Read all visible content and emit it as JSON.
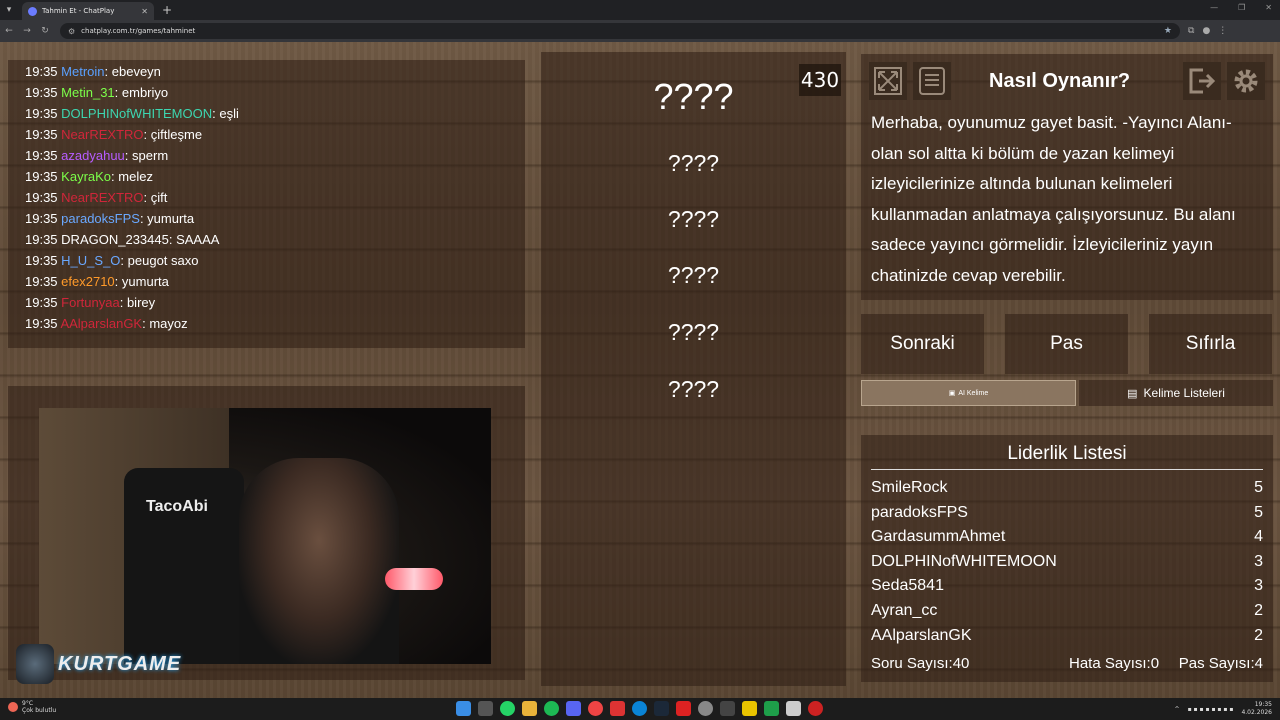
{
  "browser": {
    "tab_title": "Tahmin Et - ChatPlay",
    "url": "chatplay.com.tr/games/tahminet"
  },
  "chat": {
    "messages": [
      {
        "time": "19:35",
        "user": "Metroin",
        "color": "#5aa0ff",
        "text": "ebeveyn"
      },
      {
        "time": "19:35",
        "user": "Metin_31",
        "color": "#7cff4a",
        "text": "embriyo"
      },
      {
        "time": "19:35",
        "user": "DOLPHINofWHITEMOON",
        "color": "#3dd6b0",
        "text": "eşli"
      },
      {
        "time": "19:35",
        "user": "NearREXTRO",
        "color": "#d0263a",
        "text": "çiftleşme"
      },
      {
        "time": "19:35",
        "user": "azadyahuu",
        "color": "#b65cff",
        "text": "sperm"
      },
      {
        "time": "19:35",
        "user": "KayraKo",
        "color": "#7cff4a",
        "text": "melez"
      },
      {
        "time": "19:35",
        "user": "NearREXTRO",
        "color": "#d0263a",
        "text": "çift"
      },
      {
        "time": "19:35",
        "user": "paradoksFPS",
        "color": "#6aa8ff",
        "text": "yumurta"
      },
      {
        "time": "19:35",
        "user": "DRAGON_233445",
        "color": "#ffffff",
        "text": "SAAAA"
      },
      {
        "time": "19:35",
        "user": "H_U_S_O",
        "color": "#6aa8ff",
        "text": "peugot saxo"
      },
      {
        "time": "19:35",
        "user": "efex2710",
        "color": "#ff9a2a",
        "text": "yumurta"
      },
      {
        "time": "19:35",
        "user": "Fortunyaa",
        "color": "#d0263a",
        "text": "birey"
      },
      {
        "time": "19:35",
        "user": "AAlparslanGK",
        "color": "#d0263a",
        "text": "mayoz"
      }
    ]
  },
  "webcam": {
    "chair_text": "TacoAbi",
    "overlay_logo": "KURTGAME"
  },
  "game": {
    "score": "430",
    "words": [
      "????",
      "????",
      "????",
      "????",
      "????",
      "????"
    ]
  },
  "info": {
    "title": "Nasıl Oynanır?",
    "description": "Merhaba, oyunumuz gayet basit. -Yayıncı Alanı- olan sol altta ki bölüm de yazan kelimeyi izleyicilerinize altında bulunan kelimeleri kullanmadan anlatmaya çalışıyorsunuz. Bu alanı sadece yayıncı görmelidir. İzleyicileriniz yayın chatinizde cevap verebilir.",
    "icons": [
      "fullscreen-icon",
      "document-icon",
      "exit-icon",
      "settings-icon"
    ]
  },
  "controls": {
    "next": "Sonraki",
    "pass": "Pas",
    "reset": "Sıfırla",
    "ai_word": "AI Kelime",
    "word_lists": "Kelime Listeleri"
  },
  "leaderboard": {
    "title": "Liderlik Listesi",
    "rows": [
      {
        "name": "SmileRock",
        "score": "5"
      },
      {
        "name": "paradoksFPS",
        "score": "5"
      },
      {
        "name": "GardasummAhmet",
        "score": "4"
      },
      {
        "name": "DOLPHINofWHITEMOON",
        "score": "3"
      },
      {
        "name": "Seda5841",
        "score": "3"
      },
      {
        "name": "Ayran_cc",
        "score": "2"
      },
      {
        "name": "AAlparslanGK",
        "score": "2"
      }
    ],
    "question_count": "Soru Sayısı:40",
    "error_count": "Hata Sayısı:0",
    "pass_count": "Pas Sayısı:4"
  },
  "taskbar": {
    "temperature": "9°C",
    "weather": "Çok bulutlu",
    "time": "19:35",
    "date": "4.02.2026"
  }
}
